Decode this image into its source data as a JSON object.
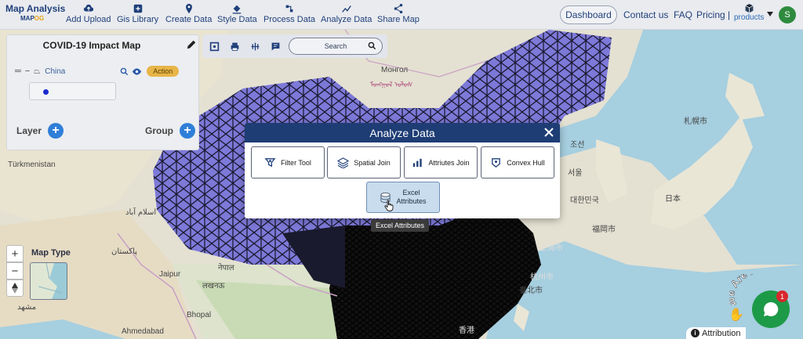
{
  "brand": {
    "title": "Map Analysis",
    "sub_a": "MAP",
    "sub_b": "OG"
  },
  "nav": [
    {
      "label": "Add Upload",
      "icon": "cloud-upload-icon"
    },
    {
      "label": "Gis Library",
      "icon": "library-icon"
    },
    {
      "label": "Create Data",
      "icon": "map-pin-icon"
    },
    {
      "label": "Style Data",
      "icon": "paint-bucket-icon"
    },
    {
      "label": "Process Data",
      "icon": "process-icon"
    },
    {
      "label": "Analyze Data",
      "icon": "analyze-icon"
    },
    {
      "label": "Share Map",
      "icon": "share-icon"
    }
  ],
  "nav_right": {
    "dashboard": "Dashboard",
    "contact": "Contact us",
    "faq": "FAQ",
    "pricing": "Pricing |",
    "products": "products",
    "avatar_initial": "S"
  },
  "panel": {
    "title": "COVID-19 Impact Map",
    "layer_name": "China",
    "action": "Action",
    "layer_label": "Layer",
    "group_label": "Group"
  },
  "toolbar": {
    "search_placeholder": "Search"
  },
  "zoom": {
    "plus": "+",
    "minus": "−"
  },
  "map_type": {
    "label": "Map Type"
  },
  "map_labels": {
    "turkmenistan": "Türkmenistan",
    "mongol": "Монгол",
    "mongol_script": "ᠮᠣᠩᠭᠣᠯ ᠤᠯᠤᠰ",
    "islam": "اسلام آباد",
    "pakistan": "پاکستان",
    "jaipur": "Jaipur",
    "nepal": "नेपाल",
    "lucknow": "लखनऊ",
    "bhopal": "Bhopal",
    "ahmedabad": "Ahmedabad",
    "mashhad": "مشهد",
    "sapporo": "札幌市",
    "japan": "日本",
    "fukuoka": "福岡市",
    "korea": "대한민국",
    "seoul": "서울",
    "north_korea": "조선",
    "taipei": "臺北市",
    "hangzhou": "杭州市",
    "shanghai": "上海市",
    "hong_kong": "香港"
  },
  "modal": {
    "title": "Analyze Data",
    "tools": [
      {
        "label": "Filter Tool",
        "icon": "filter-tool-icon"
      },
      {
        "label": "Spatial Join",
        "icon": "layers-icon"
      },
      {
        "label": "Attriutes Join",
        "icon": "bar-chart-icon"
      },
      {
        "label": "Convex Hull",
        "icon": "convex-hull-icon"
      }
    ],
    "excel_line1": "Excel",
    "excel_line2": "Attributes",
    "tooltip": "Excel Attributes"
  },
  "attribution": "Attribution",
  "chat": {
    "badge": "1",
    "banner": "We Are Here!"
  },
  "colors": {
    "nav_bg": "#e9ebef",
    "brand": "#1f3f7a",
    "modal_header": "#1e3d75",
    "fill": "#7d79d8",
    "action": "#e7b548"
  }
}
